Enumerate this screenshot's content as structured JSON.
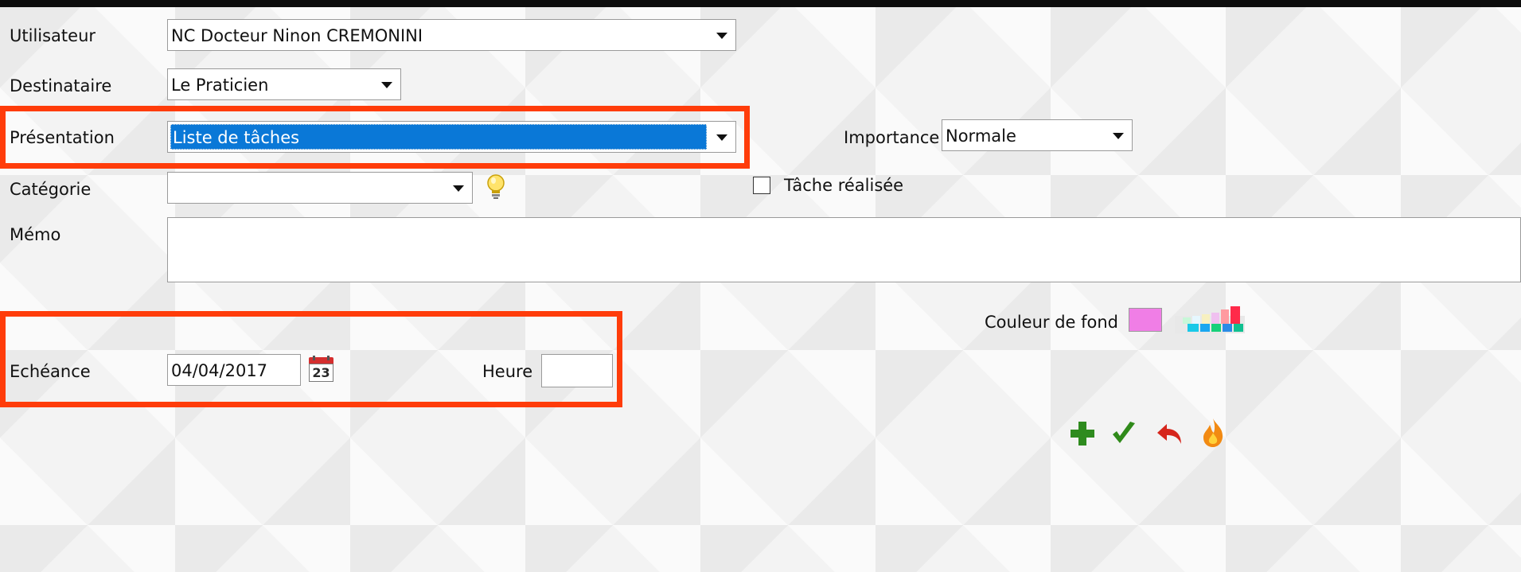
{
  "form": {
    "utilisateur": {
      "label": "Utilisateur",
      "value": "NC Docteur Ninon CREMONINI"
    },
    "destinataire": {
      "label": "Destinataire",
      "value": "Le Praticien"
    },
    "presentation": {
      "label": "Présentation",
      "value": "Liste de tâches"
    },
    "importance": {
      "label": "Importance",
      "value": "Normale"
    },
    "categorie": {
      "label": "Catégorie",
      "value": ""
    },
    "tache_realisee": {
      "label": "Tâche réalisée",
      "checked": false
    },
    "memo": {
      "label": "Mémo",
      "value": ""
    },
    "couleur_fond": {
      "label": "Couleur de fond",
      "color": "#f07ee6"
    },
    "echeance": {
      "label": "Echéance",
      "value": "04/04/2017",
      "calendar_day": "23"
    },
    "heure": {
      "label": "Heure",
      "value": ""
    }
  },
  "icons": {
    "idea": "lightbulb-icon",
    "calendar": "calendar-icon",
    "palette": "color-palette-icon",
    "add": "plus-icon",
    "validate": "check-icon",
    "undo": "undo-icon",
    "delete": "fire-icon"
  },
  "colors": {
    "highlight_frame": "#ff3c0a",
    "selection": "#0a78d7",
    "add": "#2e8b1e",
    "validate": "#2f8a1a",
    "undo": "#d6261c",
    "fire": "#f28a12"
  }
}
